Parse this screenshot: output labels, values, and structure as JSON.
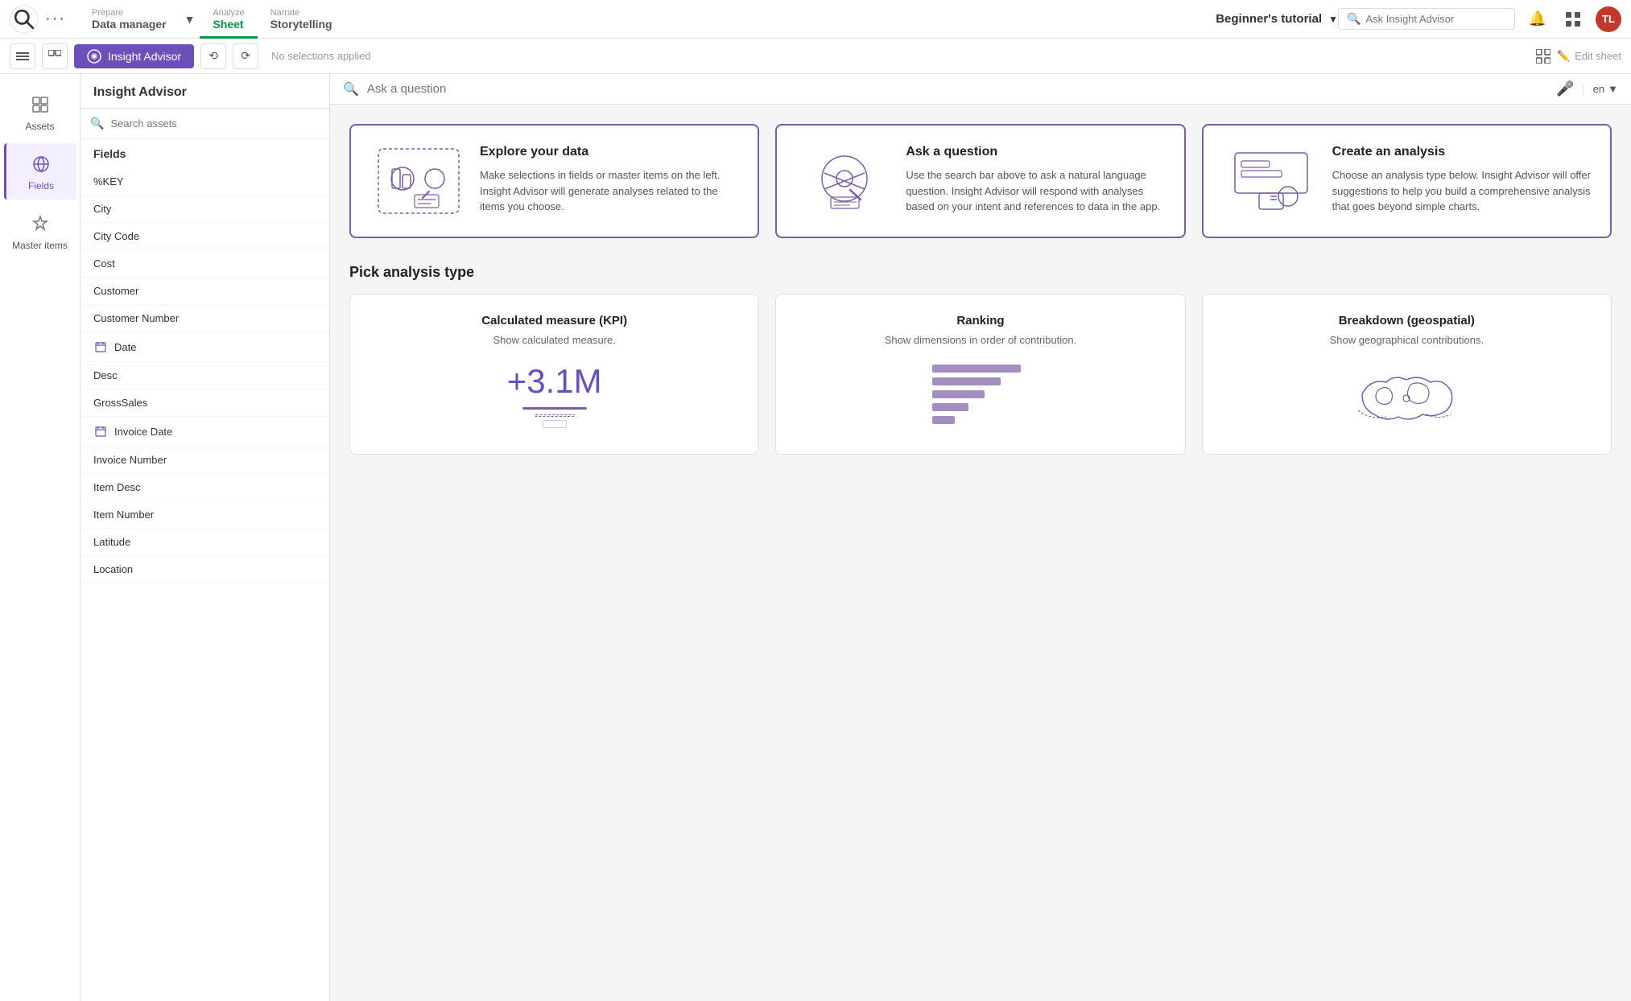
{
  "topNav": {
    "tabs": [
      {
        "id": "prepare",
        "label": "Prepare",
        "sub": "Data manager",
        "active": false
      },
      {
        "id": "analyze",
        "label": "Analyze",
        "sub": "Sheet",
        "active": true
      },
      {
        "id": "narrate",
        "label": "Narrate",
        "sub": "Storytelling",
        "active": false
      }
    ],
    "appTitle": "Beginner's tutorial",
    "searchPlaceholder": "Ask Insight Advisor",
    "avatarInitials": "TL"
  },
  "toolbar2": {
    "insightAdvisorLabel": "Insight Advisor",
    "noSelectionsLabel": "No selections applied",
    "editSheetLabel": "Edit sheet"
  },
  "leftPanel": {
    "items": [
      {
        "id": "assets",
        "label": "Assets",
        "active": false
      },
      {
        "id": "fields",
        "label": "Fields",
        "active": true
      },
      {
        "id": "master-items",
        "label": "Master items",
        "active": false
      }
    ]
  },
  "insightPanel": {
    "title": "Insight Advisor",
    "searchPlaceholder": "Search assets",
    "fieldsHeader": "Fields",
    "fields": [
      {
        "id": "key",
        "label": "%KEY",
        "hasIcon": false
      },
      {
        "id": "city",
        "label": "City",
        "hasIcon": false
      },
      {
        "id": "city-code",
        "label": "City Code",
        "hasIcon": false
      },
      {
        "id": "cost",
        "label": "Cost",
        "hasIcon": false
      },
      {
        "id": "customer",
        "label": "Customer",
        "hasIcon": false
      },
      {
        "id": "customer-number",
        "label": "Customer Number",
        "hasIcon": false
      },
      {
        "id": "date",
        "label": "Date",
        "hasIcon": true
      },
      {
        "id": "desc",
        "label": "Desc",
        "hasIcon": false
      },
      {
        "id": "gross-sales",
        "label": "GrossSales",
        "hasIcon": false
      },
      {
        "id": "invoice-date",
        "label": "Invoice Date",
        "hasIcon": true
      },
      {
        "id": "invoice-number",
        "label": "Invoice Number",
        "hasIcon": false
      },
      {
        "id": "item-desc",
        "label": "Item Desc",
        "hasIcon": false
      },
      {
        "id": "item-number",
        "label": "Item Number",
        "hasIcon": false
      },
      {
        "id": "latitude",
        "label": "Latitude",
        "hasIcon": false
      },
      {
        "id": "location",
        "label": "Location",
        "hasIcon": false
      }
    ]
  },
  "questionBar": {
    "placeholder": "Ask a question",
    "language": "en"
  },
  "infoCards": [
    {
      "id": "explore",
      "title": "Explore your data",
      "desc": "Make selections in fields or master items on the left. Insight Advisor will generate analyses related to the items you choose."
    },
    {
      "id": "ask",
      "title": "Ask a question",
      "desc": "Use the search bar above to ask a natural language question. Insight Advisor will respond with analyses based on your intent and references to data in the app."
    },
    {
      "id": "create",
      "title": "Create an analysis",
      "desc": "Choose an analysis type below. Insight Advisor will offer suggestions to help you build a comprehensive analysis that goes beyond simple charts."
    }
  ],
  "analysisSection": {
    "title": "Pick analysis type",
    "cards": [
      {
        "id": "kpi",
        "title": "Calculated measure (KPI)",
        "desc": "Show calculated measure.",
        "kpiValue": "+3.1M"
      },
      {
        "id": "ranking",
        "title": "Ranking",
        "desc": "Show dimensions in order of contribution."
      },
      {
        "id": "geo",
        "title": "Breakdown (geospatial)",
        "desc": "Show geographical contributions."
      }
    ]
  },
  "colors": {
    "purple": "#6b4fbb",
    "purpleBorder": "#7b5ea7",
    "green": "#009845"
  }
}
